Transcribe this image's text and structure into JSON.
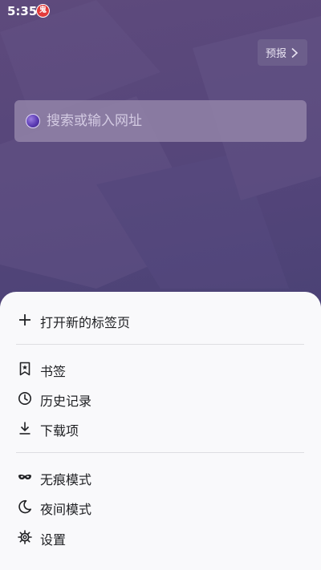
{
  "status_bar": {
    "time": "5:35",
    "notification_badge": "鬼"
  },
  "header": {
    "forecast_label": "预报"
  },
  "search": {
    "placeholder": "搜索或输入网址"
  },
  "menu": {
    "groups": [
      {
        "items": [
          {
            "label": "打开新的标签页",
            "icon": "plus-icon"
          }
        ]
      },
      {
        "items": [
          {
            "label": "书签",
            "icon": "bookmark-star-icon"
          },
          {
            "label": "历史记录",
            "icon": "clock-icon"
          },
          {
            "label": "下载项",
            "icon": "download-icon"
          }
        ]
      },
      {
        "items": [
          {
            "label": "无痕模式",
            "icon": "incognito-mask-icon"
          },
          {
            "label": "夜间模式",
            "icon": "moon-icon"
          },
          {
            "label": "设置",
            "icon": "gear-icon"
          }
        ]
      }
    ]
  },
  "colors": {
    "background_top": "#5e4a7c",
    "background_bottom": "#3f3c6c",
    "sheet_background": "#f9f9fb",
    "text_primary": "#202124",
    "badge_red": "#e23b3b"
  }
}
